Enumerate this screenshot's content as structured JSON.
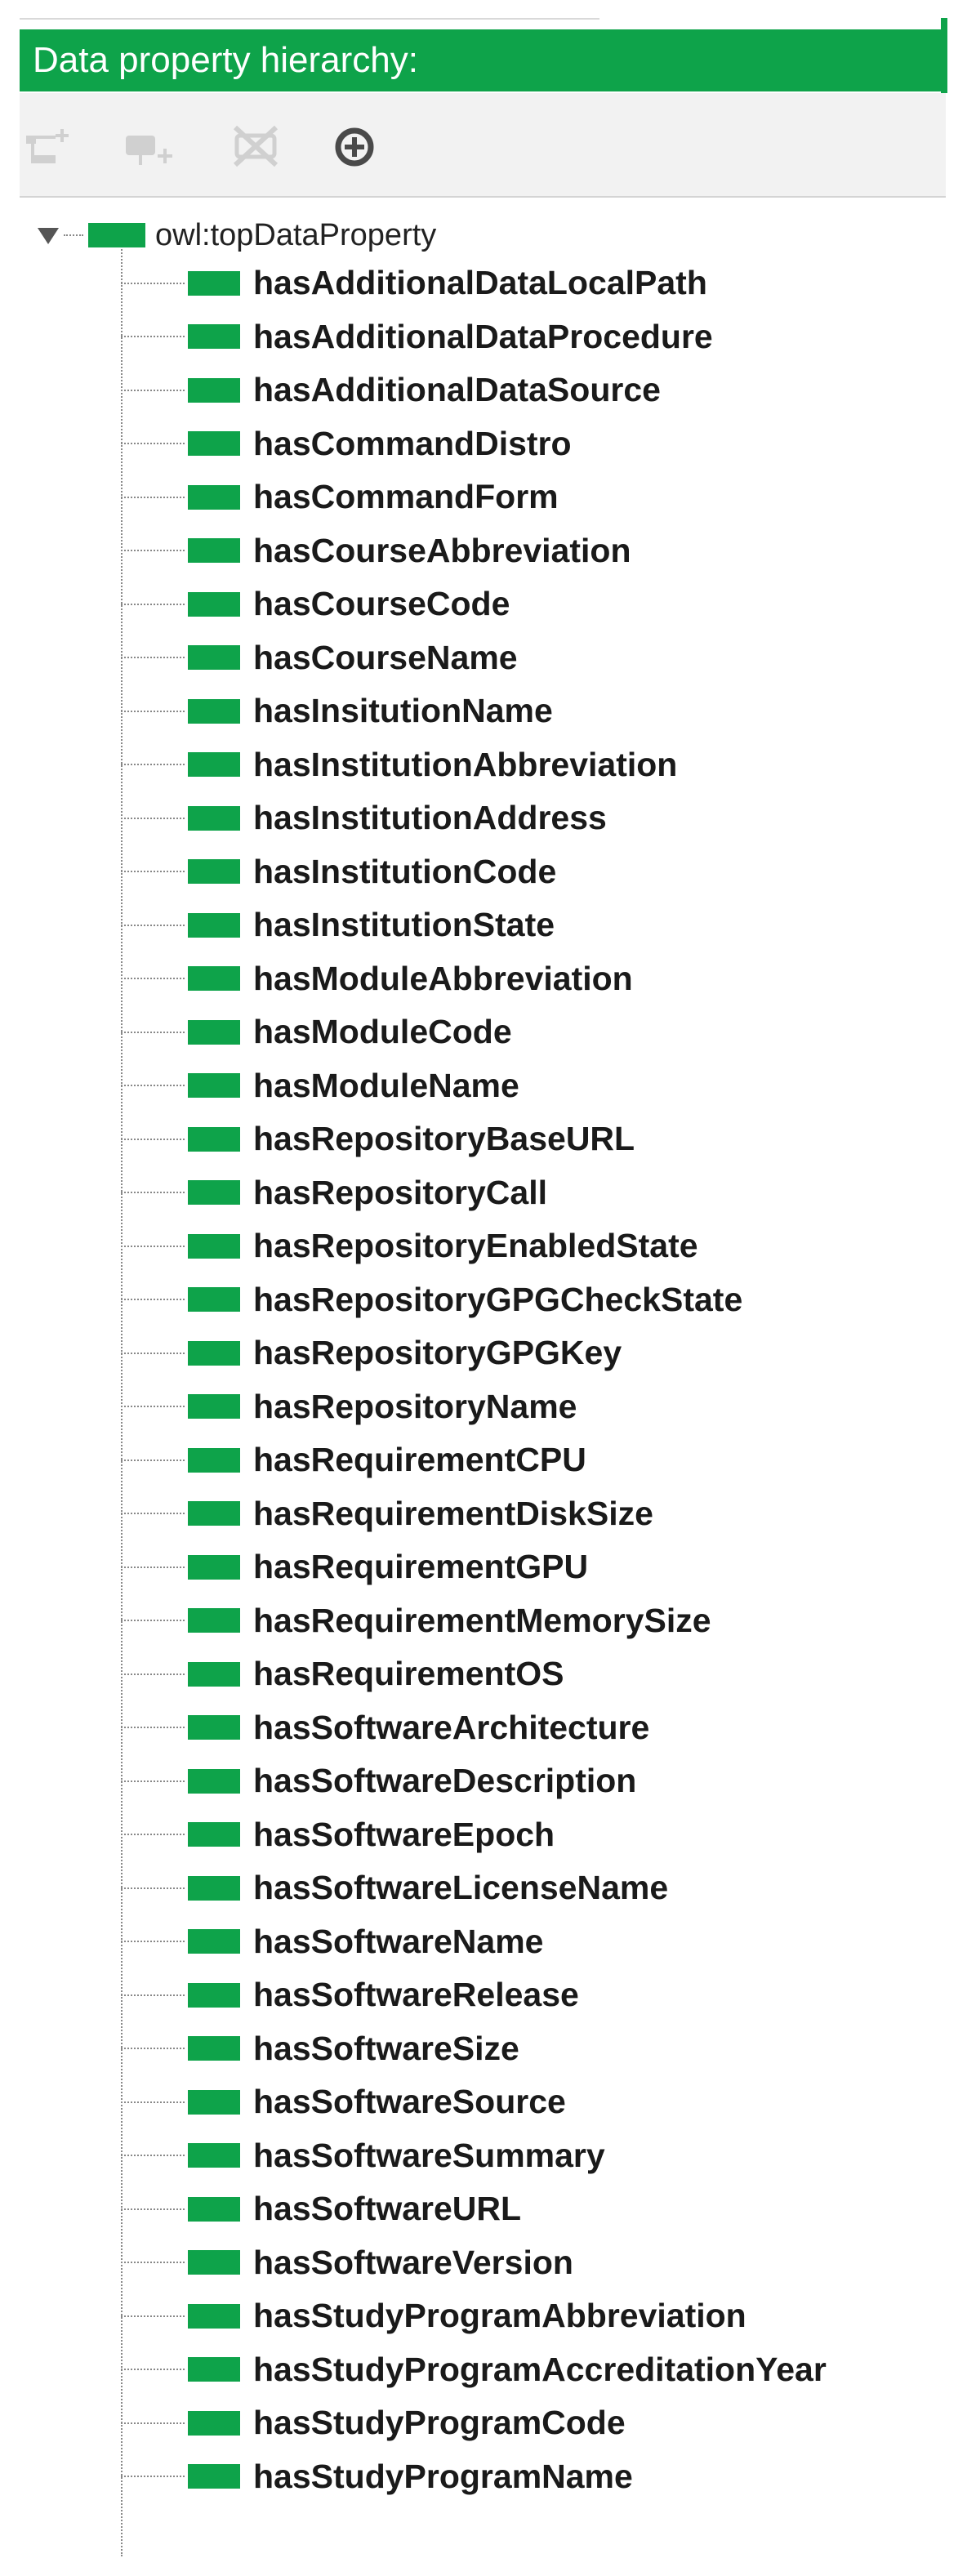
{
  "panel": {
    "title": "Data property hierarchy:"
  },
  "colors": {
    "header_bg": "#0ea34a",
    "swatch": "#0ea34a",
    "toolbar_bg": "#f2f2f2"
  },
  "toolbar": {
    "buttons": [
      {
        "icon": "add-subproperty-icon",
        "enabled": false
      },
      {
        "icon": "add-sibling-property-icon",
        "enabled": false
      },
      {
        "icon": "delete-property-icon",
        "enabled": false
      },
      {
        "icon": "find-usage-icon",
        "enabled": true
      }
    ]
  },
  "tree": {
    "root": {
      "label": "owl:topDataProperty",
      "expanded": true
    },
    "children": [
      "hasAdditionalDataLocalPath",
      "hasAdditionalDataProcedure",
      "hasAdditionalDataSource",
      "hasCommandDistro",
      "hasCommandForm",
      "hasCourseAbbreviation",
      "hasCourseCode",
      "hasCourseName",
      "hasInsitutionName",
      "hasInstitutionAbbreviation",
      "hasInstitutionAddress",
      "hasInstitutionCode",
      "hasInstitutionState",
      "hasModuleAbbreviation",
      "hasModuleCode",
      "hasModuleName",
      "hasRepositoryBaseURL",
      "hasRepositoryCall",
      "hasRepositoryEnabledState",
      "hasRepositoryGPGCheckState",
      "hasRepositoryGPGKey",
      "hasRepositoryName",
      "hasRequirementCPU",
      "hasRequirementDiskSize",
      "hasRequirementGPU",
      "hasRequirementMemorySize",
      "hasRequirementOS",
      "hasSoftwareArchitecture",
      "hasSoftwareDescription",
      "hasSoftwareEpoch",
      "hasSoftwareLicenseName",
      "hasSoftwareName",
      "hasSoftwareRelease",
      "hasSoftwareSize",
      "hasSoftwareSource",
      "hasSoftwareSummary",
      "hasSoftwareURL",
      "hasSoftwareVersion",
      "hasStudyProgramAbbreviation",
      "hasStudyProgramAccreditationYear",
      "hasStudyProgramCode",
      "hasStudyProgramName"
    ]
  }
}
